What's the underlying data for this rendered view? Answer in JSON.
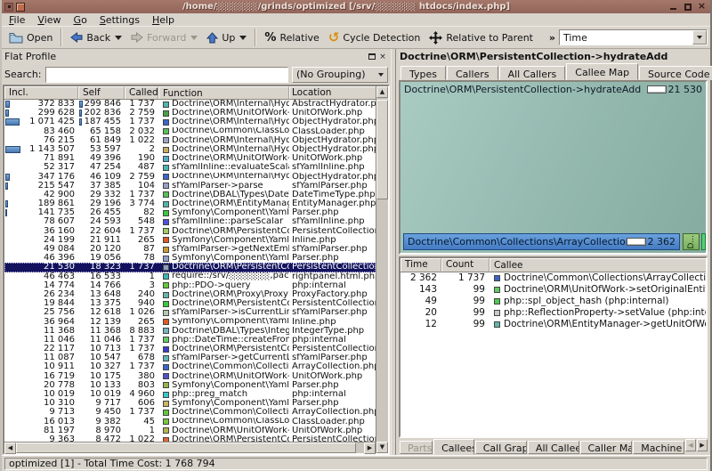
{
  "window": {
    "title": "/home/░░░░░░/grinds/optimized [/srv/░░░░░░ htdocs/index.php]"
  },
  "menu": {
    "items": [
      "File",
      "View",
      "Go",
      "Settings",
      "Help"
    ]
  },
  "toolbar": {
    "open": "Open",
    "back": "Back",
    "forward": "Forward",
    "up": "Up",
    "relative": "Relative",
    "percent": "%",
    "cycle_detection": "Cycle Detection",
    "relative_to_parent": "Relative to Parent",
    "overflow_chevron": "»",
    "event_type_combo": "Time"
  },
  "flat_profile": {
    "dock_title": "Flat Profile",
    "search_label": "Search:",
    "search_value": "",
    "grouping_combo": "(No Grouping)",
    "headers": [
      "Incl.",
      "Self",
      "Called",
      "Function",
      "Location"
    ],
    "rows": [
      {
        "incl": "372 833",
        "self": "299 846",
        "called": "1 737",
        "color": "#4fb6ac",
        "func": "Doctrine\\ORM\\Internal\\Hyd...",
        "loc": "AbstractHydrator.ph"
      },
      {
        "incl": "299 628",
        "self": "202 836",
        "called": "2 759",
        "color": "#46a046",
        "func": "Doctrine\\ORM\\UnitOfWork-...",
        "loc": "UnitOfWork.php"
      },
      {
        "incl": "1 071 425",
        "self": "187 455",
        "called": "1 737",
        "color": "#3c64c8",
        "func": "Doctrine\\ORM\\Internal\\Hyd...",
        "loc": "ObjectHydrator.php"
      },
      {
        "incl": "83 460",
        "self": "65 158",
        "called": "2 032",
        "color": "#5abe5a",
        "func": "Doctrine\\Common\\ClassLoa...",
        "loc": "ClassLoader.php"
      },
      {
        "incl": "76 215",
        "self": "61 849",
        "called": "1 022",
        "color": "#9aa4c8",
        "func": "Doctrine\\ORM\\Internal\\Hyd...",
        "loc": "ObjectHydrator.php"
      },
      {
        "incl": "1 143 507",
        "self": "53 597",
        "called": "2",
        "color": "#c8aa64",
        "func": "Doctrine\\ORM\\Internal\\Hyd...",
        "loc": "ObjectHydrator.php"
      },
      {
        "incl": "71 891",
        "self": "49 396",
        "called": "190",
        "color": "#50aac8",
        "func": "Doctrine\\ORM\\UnitOfWork-...",
        "loc": "UnitOfWork.php"
      },
      {
        "incl": "52 317",
        "self": "47 254",
        "called": "487",
        "color": "#50b4aa",
        "func": "sfYamlInline::evaluateScalar",
        "loc": "sfYamlInline.php"
      },
      {
        "incl": "347 176",
        "self": "46 109",
        "called": "2 759",
        "color": "#3c64c8",
        "func": "Doctrine\\ORM\\Internal\\Hyd...",
        "loc": "ObjectHydrator.php"
      },
      {
        "incl": "215 547",
        "self": "37 385",
        "called": "104",
        "color": "#96a0c8",
        "func": "sfYamlParser->parse",
        "loc": "sfYamlParser.php"
      },
      {
        "incl": "42 900",
        "self": "29 332",
        "called": "1 737",
        "color": "#5abe5a",
        "func": "Doctrine\\DBAL\\Types\\DateT...",
        "loc": "DateTimeType.php"
      },
      {
        "incl": "189 861",
        "self": "29 196",
        "called": "3 774",
        "color": "#50b4aa",
        "func": "Doctrine\\ORM\\EntityManag...",
        "loc": "EntityManager.php"
      },
      {
        "incl": "141 735",
        "self": "26 455",
        "called": "82",
        "color": "#3cc83c",
        "func": "Symfony\\Component\\Yaml\\...",
        "loc": "Parser.php"
      },
      {
        "incl": "78 607",
        "self": "24 593",
        "called": "548",
        "color": "#5050dc",
        "func": "sfYamlInline::parseScalar",
        "loc": "sfYamlInline.php"
      },
      {
        "incl": "36 160",
        "self": "22 604",
        "called": "1 737",
        "color": "#a0c864",
        "func": "Doctrine\\ORM\\PersistentCol...",
        "loc": "PersistentCollection.p"
      },
      {
        "incl": "24 199",
        "self": "21 911",
        "called": "265",
        "color": "#dc5a28",
        "func": "Symfony\\Component\\Yaml\\...",
        "loc": "Inline.php"
      },
      {
        "incl": "49 084",
        "self": "20 120",
        "called": "87",
        "color": "#c89c32",
        "func": "sfYamlParser->getNextEmb...",
        "loc": "sfYamlParser.php"
      },
      {
        "incl": "46 396",
        "self": "19 056",
        "called": "78",
        "color": "#8ca0c8",
        "func": "Symfony\\Component\\Yaml\\...",
        "loc": "Parser.php"
      },
      {
        "incl": "21 530",
        "self": "18 323",
        "called": "1 737",
        "color": "#8ca0b4",
        "func": "Doctrine\\ORM\\PersistentCol...",
        "loc": "PersistentCollection.p",
        "selected": true
      },
      {
        "incl": "46 463",
        "self": "16 533",
        "called": "1",
        "color": "#3cb4b4",
        "func": "require::/srv/░░░░░░,pack...",
        "loc": "rightpanel.html.php"
      },
      {
        "incl": "14 774",
        "self": "14 766",
        "called": "3",
        "color": "#64c83c",
        "func": "php::PDO->query",
        "loc": "php:internal"
      },
      {
        "incl": "26 234",
        "self": "13 648",
        "called": "240",
        "color": "#64b4aa",
        "func": "Doctrine\\ORM\\Proxy\\ProxyF...",
        "loc": "ProxyFactory.php"
      },
      {
        "incl": "19 844",
        "self": "13 375",
        "called": "940",
        "color": "#3cc83c",
        "func": "Doctrine\\ORM\\PersistentCol...",
        "loc": "PersistentCollection.p"
      },
      {
        "incl": "25 756",
        "self": "12 618",
        "called": "1 026",
        "color": "#b4c8b4",
        "func": "sfYamlParser->isCurrentLin...",
        "loc": "sfYamlParser.php"
      },
      {
        "incl": "36 964",
        "self": "12 139",
        "called": "265",
        "color": "#dc5a28",
        "func": "Symfony\\Component\\Yaml\\...",
        "loc": "Inline.php"
      },
      {
        "incl": "11 368",
        "self": "11 368",
        "called": "8 883",
        "color": "#78b4be",
        "func": "Doctrine\\DBAL\\Types\\Integ...",
        "loc": "IntegerType.php"
      },
      {
        "incl": "11 046",
        "self": "11 046",
        "called": "1 737",
        "color": "#64c864",
        "func": "php::DateTime::createFrom...",
        "loc": "php:internal"
      },
      {
        "incl": "22 117",
        "self": "10 713",
        "called": "1 737",
        "color": "#3c3cc8",
        "func": "Doctrine\\ORM\\PersistentCol...",
        "loc": "PersistentCollection.p"
      },
      {
        "incl": "11 087",
        "self": "10 547",
        "called": "678",
        "color": "#64b4b4",
        "func": "sfYamlParser->getCurrentLi...",
        "loc": "sfYamlParser.php"
      },
      {
        "incl": "10 911",
        "self": "10 327",
        "called": "1 737",
        "color": "#3c64c8",
        "func": "Doctrine\\Common\\Collectio...",
        "loc": "ArrayCollection.php"
      },
      {
        "incl": "16 719",
        "self": "10 175",
        "called": "380",
        "color": "#5050c8",
        "func": "Doctrine\\ORM\\UnitOfWork-...",
        "loc": "UnitOfWork.php"
      },
      {
        "incl": "20 778",
        "self": "10 133",
        "called": "803",
        "color": "#96b450",
        "func": "Symfony\\Component\\Yaml\\...",
        "loc": "Parser.php"
      },
      {
        "incl": "10 019",
        "self": "10 019",
        "called": "4 960",
        "color": "#3cc8c8",
        "func": "php::preg_match",
        "loc": "php:internal"
      },
      {
        "incl": "10 310",
        "self": "9 717",
        "called": "606",
        "color": "#c8b464",
        "func": "Symfony\\Component\\Yaml\\...",
        "loc": "Parser.php"
      },
      {
        "incl": "9 713",
        "self": "9 450",
        "called": "1 737",
        "color": "#64c83c",
        "func": "Doctrine\\Common\\Collectio...",
        "loc": "ArrayCollection.php"
      },
      {
        "incl": "16 013",
        "self": "9 382",
        "called": "45",
        "color": "#78c83c",
        "func": "Doctrine\\Common\\ClassLoa...",
        "loc": "ClassLoader.php"
      },
      {
        "incl": "81 197",
        "self": "8 970",
        "called": "1",
        "color": "#b4b450",
        "func": "Doctrine\\ORM\\UnitOfWork-...",
        "loc": "UnitOfWork.php"
      },
      {
        "incl": "9 363",
        "self": "8 472",
        "called": "1 022",
        "color": "#dc643c",
        "func": "Doctrine\\ORM\\PersistentCol...",
        "loc": "PersistentCollection.p"
      }
    ]
  },
  "right_panel": {
    "title": "Doctrine\\ORM\\PersistentCollection->hydrateAdd",
    "tabs": [
      {
        "label": "Types"
      },
      {
        "label": "Callers"
      },
      {
        "label": "All Callers"
      },
      {
        "label": "Callee Map",
        "active": true
      },
      {
        "label": "Source Code"
      }
    ],
    "callee_map": {
      "root_label": "Doctrine\\ORM\\PersistentCollection->hydrateAdd",
      "root_cost": "21 530",
      "child_label": "Doctrine\\Common\\Collections\\ArrayCollection->add",
      "child_cost": "2 362",
      "small_child_label": "D..."
    },
    "callee_list": {
      "headers": [
        "Time",
        "Count",
        "Callee"
      ],
      "rows": [
        {
          "time": "2 362",
          "count": "1 737",
          "color": "#3c64c8",
          "callee": "Doctrine\\Common\\Collections\\ArrayCollection->add (Arra..."
        },
        {
          "time": "143",
          "count": "99",
          "color": "#64c864",
          "callee": "Doctrine\\ORM\\UnitOfWork->setOriginalEntityProperty (Un..."
        },
        {
          "time": "49",
          "count": "99",
          "color": "#50c850",
          "callee": "php::spl_object_hash (php:internal)"
        },
        {
          "time": "20",
          "count": "99",
          "color": "#c4ccc4",
          "callee": "php::ReflectionProperty->setValue (php:internal)"
        },
        {
          "time": "12",
          "count": "99",
          "color": "#64b4aa",
          "callee": "Doctrine\\ORM\\EntityManager->getUnitOfWork (EntityMan..."
        }
      ]
    },
    "bottom_tabs": [
      {
        "label": "Parts",
        "disabled": true
      },
      {
        "label": "Callees",
        "active": true
      },
      {
        "label": "Call Graph"
      },
      {
        "label": "All Callees"
      },
      {
        "label": "Caller Map"
      },
      {
        "label": "Machine C",
        "clipped": true
      }
    ]
  },
  "statusbar": {
    "text": "optimized [1] - Total Time Cost: 1 768 794"
  },
  "totals": {
    "total_cost": 1768794
  }
}
